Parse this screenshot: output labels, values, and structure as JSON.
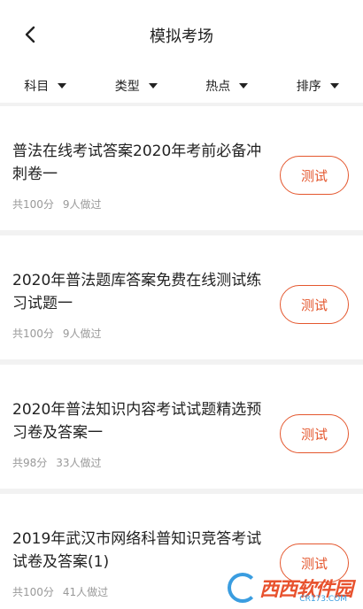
{
  "header": {
    "title": "模拟考场"
  },
  "filters": [
    {
      "label": "科目"
    },
    {
      "label": "类型"
    },
    {
      "label": "热点"
    },
    {
      "label": "排序"
    }
  ],
  "exams": [
    {
      "title": "普法在线考试答案2020年考前必备冲刺卷一",
      "score": "共100分",
      "participants": "9人做过",
      "action": "测试"
    },
    {
      "title": "2020年普法题库答案免费在线测试练习试题一",
      "score": "共100分",
      "participants": "9人做过",
      "action": "测试"
    },
    {
      "title": "2020年普法知识内容考试试题精选预习卷及答案一",
      "score": "共98分",
      "participants": "33人做过",
      "action": "测试"
    },
    {
      "title": "2019年武汉市网络科普知识竞答考试试卷及答案(1)",
      "score": "共100分",
      "participants": "41人做过",
      "action": "测试"
    }
  ],
  "watermark": {
    "text": "西西软件园",
    "sub": "CR173.COM"
  },
  "colors": {
    "accent": "#e4572e",
    "meta": "#999999",
    "background": "#f2f2f2"
  }
}
